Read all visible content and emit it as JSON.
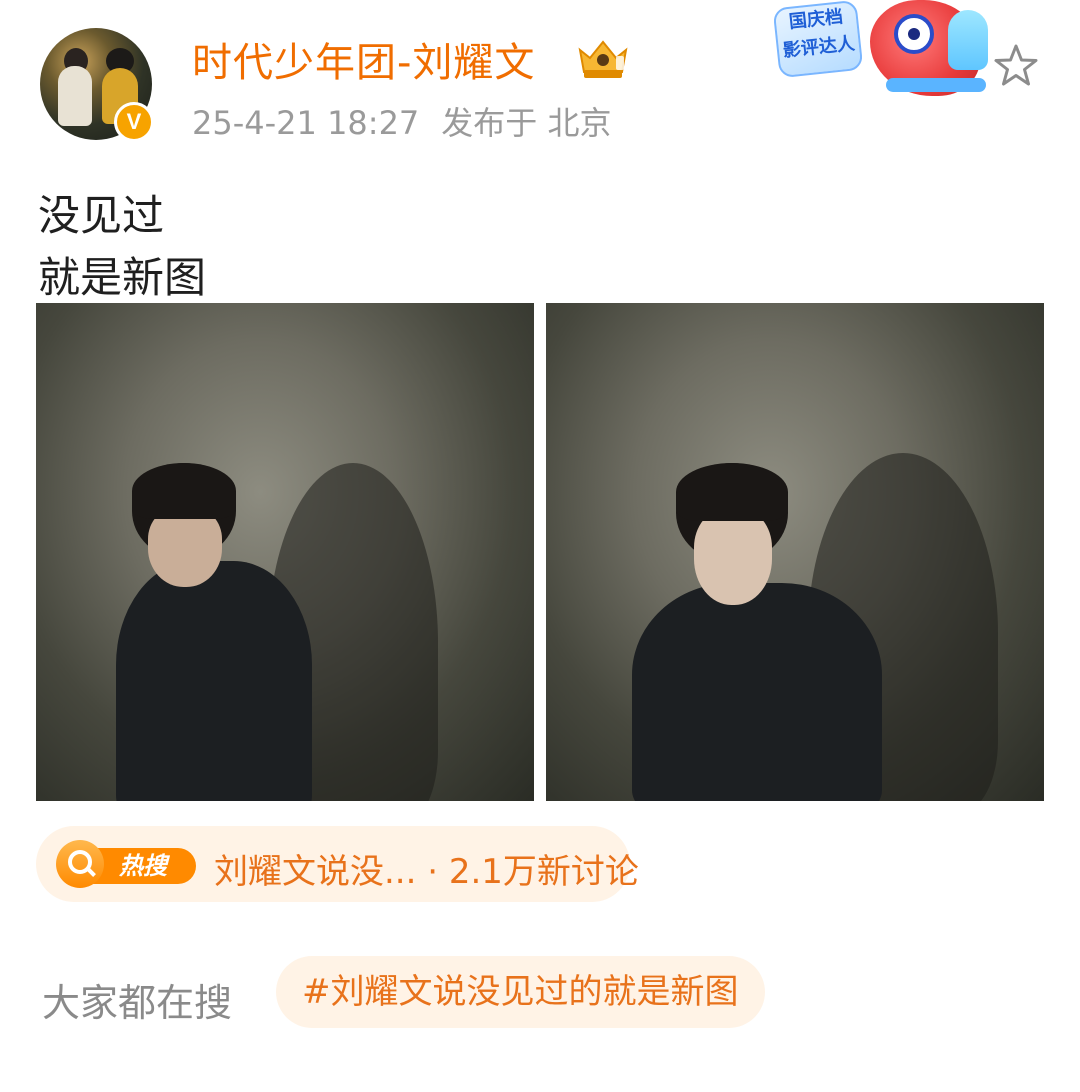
{
  "header": {
    "username": "时代少年团-刘耀文",
    "timestamp": "25-4-21 18:27",
    "location": "发布于 北京",
    "verified_badge": "V",
    "promo_tag": [
      "国庆档",
      "影评达人"
    ]
  },
  "post": {
    "lines": [
      "没见过",
      "就是新图"
    ],
    "images": [
      "photo-1",
      "photo-2"
    ]
  },
  "hot_search": {
    "badge": "热搜",
    "text": "刘耀文说没... · 2.1万新讨论"
  },
  "related": {
    "label": "大家都在搜",
    "chip": "#刘耀文说没见过的就是新图"
  },
  "icons": {
    "crown": "crown-badge-icon",
    "star": "favorite-star-icon",
    "search": "search-icon"
  },
  "colors": {
    "accent": "#f06d00",
    "hot_bg": "#fff3e6",
    "verified": "#f7a300"
  }
}
